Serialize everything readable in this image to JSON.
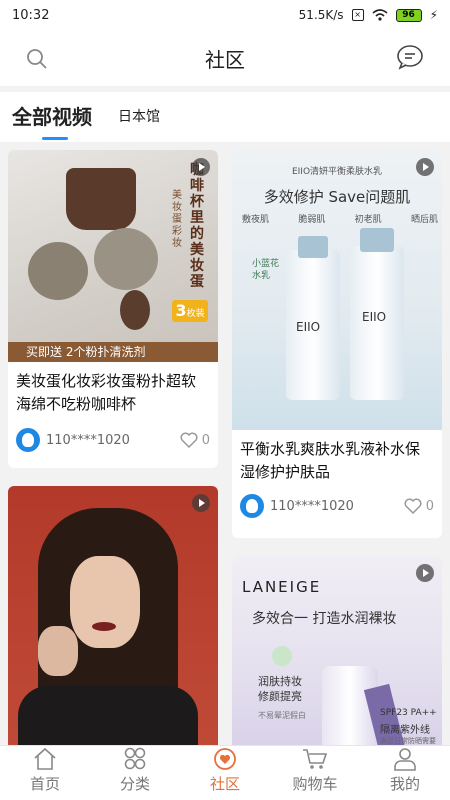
{
  "status": {
    "time": "10:32",
    "speed": "51.5K/s",
    "battery": "96"
  },
  "header": {
    "title": "社区"
  },
  "tabs": [
    {
      "label": "全部视频"
    },
    {
      "label": "日本馆"
    }
  ],
  "posts": [
    {
      "title": "美妆蛋化妆彩妆蛋粉扑超软海绵不吃粉咖啡杯",
      "user": "110****1020",
      "likes": "0",
      "image_text": {
        "vertical": "咖啡杯里的美妆蛋",
        "side": "美妆蛋彩妆",
        "count": "3",
        "count_unit": "枚装",
        "banner": "买即送 2个粉扑清洗剂"
      }
    },
    {
      "title": "平衡水乳爽肤水乳液补水保湿修护护肤品",
      "user": "110****1020",
      "likes": "0",
      "image_text": {
        "top": "EIIO清妍平衡柔肤水乳",
        "headline": "多效修护  Save问题肌",
        "tags": [
          "敷夜肌",
          "脆弱肌",
          "初老肌",
          "晒后肌"
        ],
        "badge": "小蓝花 水乳",
        "brand": "EIIO"
      }
    },
    {
      "title": "",
      "user": "",
      "likes": ""
    },
    {
      "title": "",
      "user": "",
      "likes": "",
      "image_text": {
        "brand": "LANEIGE",
        "headline": "多效合一  打造水润裸妆",
        "bullet": "润肤持妆 修颜提亮",
        "note": "不易晕泥假白",
        "spf": "SPF23 PA++",
        "spf_label": "隔离紫外线",
        "small": "满足日常防晒需要"
      }
    }
  ],
  "nav": [
    {
      "label": "首页"
    },
    {
      "label": "分类"
    },
    {
      "label": "社区"
    },
    {
      "label": "购物车"
    },
    {
      "label": "我的"
    }
  ],
  "colors": {
    "accent": "#1e90ff",
    "nav_active": "#e8703a",
    "avatar": "#1e88e5"
  }
}
